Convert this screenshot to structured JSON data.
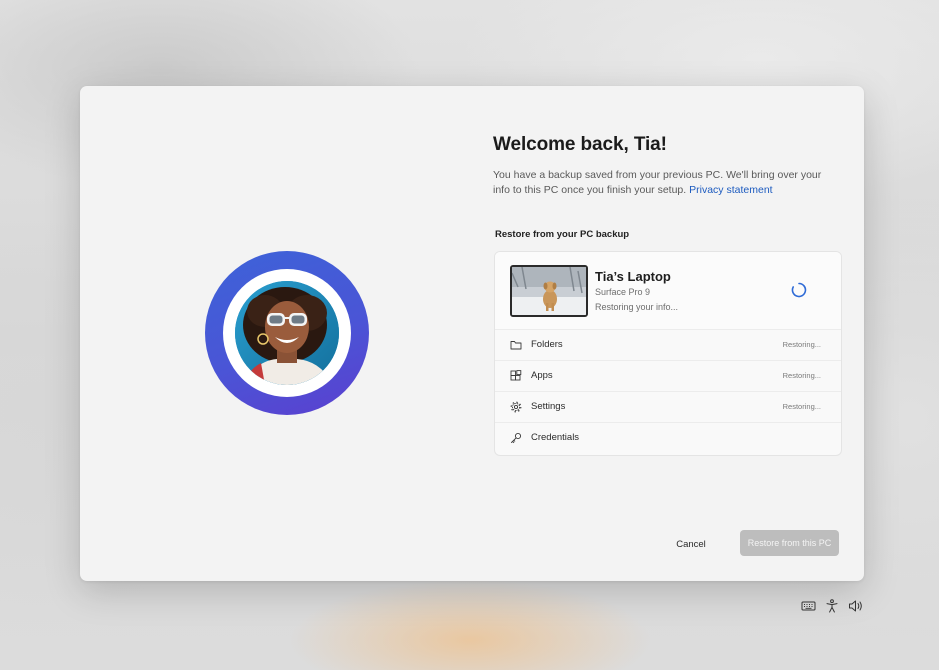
{
  "dialog": {
    "title": "Welcome back, Tia!",
    "description": "You have a backup saved from your previous PC. We'll bring over your info to this PC once you finish your setup.",
    "privacy_link": "Privacy statement",
    "section_label": "Restore from your PC backup",
    "device": {
      "name": "Tia’s Laptop",
      "model": "Surface Pro 9",
      "status": "Restoring your info...",
      "spinner_icon": "loading-spinner-icon"
    },
    "items": [
      {
        "label": "Folders",
        "status": "Restoring...",
        "icon": "folder-icon"
      },
      {
        "label": "Apps",
        "status": "Restoring...",
        "icon": "apps-icon"
      },
      {
        "label": "Settings",
        "status": "Restoring...",
        "icon": "gear-icon"
      },
      {
        "label": "Credentials",
        "status": "",
        "icon": "key-icon"
      }
    ],
    "buttons": {
      "cancel": "Cancel",
      "restore": "Restore from this PC"
    }
  },
  "tray": {
    "icons": [
      "keyboard-icon",
      "accessibility-icon",
      "volume-icon"
    ]
  },
  "colors": {
    "avatar_ring": "#4a55d6",
    "link": "#1d5bbf",
    "spinner": "#2f6bd6",
    "primary_button_disabled": "#bdbdbd"
  }
}
